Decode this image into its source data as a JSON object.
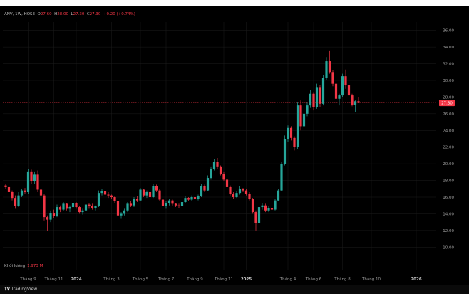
{
  "header": {
    "symbol": "ANV, 1W, HOSE",
    "o_label": "O",
    "o_value": "27.60",
    "h_label": "H",
    "h_value": "28.00",
    "l_label": "L",
    "l_value": "27.30",
    "c_label": "C",
    "c_value": "27.30",
    "change": "+0.20 (+0.74%)"
  },
  "volume": {
    "label": "Khối lượng",
    "value": "1.973 M"
  },
  "footer": {
    "brand": "TradingView"
  },
  "colors": {
    "up": "#26a69a",
    "down": "#f23645",
    "bg": "#000000",
    "grid": "#1c1c1c"
  },
  "chart_data": {
    "type": "candlestick",
    "ylim": [
      9,
      37
    ],
    "y_ticks": [
      "10.00",
      "12.00",
      "14.00",
      "16.00",
      "18.00",
      "20.00",
      "22.00",
      "24.00",
      "26.00",
      "28.00",
      "30.00",
      "32.00",
      "34.00",
      "36.00"
    ],
    "last_price": "27.30",
    "x_ticks": [
      {
        "label": "Tháng 9",
        "bold": false,
        "pos": 7
      },
      {
        "label": "Tháng 11",
        "bold": false,
        "pos": 15
      },
      {
        "label": "2024",
        "bold": true,
        "pos": 22
      },
      {
        "label": "Tháng 3",
        "bold": false,
        "pos": 33
      },
      {
        "label": "Tháng 5",
        "bold": false,
        "pos": 42
      },
      {
        "label": "Tháng 7",
        "bold": false,
        "pos": 50
      },
      {
        "label": "Tháng 9",
        "bold": false,
        "pos": 59
      },
      {
        "label": "Tháng 11",
        "bold": false,
        "pos": 68
      },
      {
        "label": "2025",
        "bold": true,
        "pos": 75
      },
      {
        "label": "Tháng 4",
        "bold": false,
        "pos": 88
      },
      {
        "label": "Tháng 6",
        "bold": false,
        "pos": 96
      },
      {
        "label": "Tháng 8",
        "bold": false,
        "pos": 105
      },
      {
        "label": "Tháng 10",
        "bold": false,
        "pos": 114
      },
      {
        "label": "2026",
        "bold": true,
        "pos": 128
      }
    ],
    "ohlc": [
      [
        17.4,
        17.6,
        17.0,
        17.2
      ],
      [
        17.2,
        17.3,
        16.4,
        16.6
      ],
      [
        16.6,
        16.8,
        15.6,
        15.9
      ],
      [
        15.9,
        16.2,
        14.6,
        14.9
      ],
      [
        14.9,
        16.6,
        14.8,
        16.2
      ],
      [
        16.2,
        17.0,
        16.0,
        16.8
      ],
      [
        16.8,
        17.1,
        16.4,
        16.6
      ],
      [
        16.6,
        19.4,
        16.4,
        19.0
      ],
      [
        19.0,
        19.3,
        17.6,
        17.9
      ],
      [
        17.9,
        19.0,
        17.6,
        18.7
      ],
      [
        18.7,
        19.2,
        16.6,
        16.9
      ],
      [
        16.9,
        17.0,
        15.8,
        16.2
      ],
      [
        16.2,
        16.4,
        13.2,
        13.6
      ],
      [
        13.6,
        13.8,
        11.9,
        13.3
      ],
      [
        13.3,
        14.4,
        13.0,
        14.1
      ],
      [
        14.1,
        14.5,
        13.5,
        13.7
      ],
      [
        13.7,
        15.1,
        13.6,
        14.8
      ],
      [
        14.8,
        15.0,
        14.2,
        14.5
      ],
      [
        14.5,
        15.4,
        14.3,
        15.2
      ],
      [
        15.2,
        15.3,
        14.4,
        14.6
      ],
      [
        14.6,
        15.0,
        14.2,
        14.8
      ],
      [
        14.8,
        15.6,
        14.6,
        15.3
      ],
      [
        15.3,
        15.4,
        14.6,
        14.8
      ],
      [
        14.8,
        14.9,
        14.0,
        14.2
      ],
      [
        14.2,
        14.6,
        13.9,
        14.4
      ],
      [
        14.4,
        15.4,
        14.3,
        15.1
      ],
      [
        15.1,
        15.3,
        14.6,
        14.9
      ],
      [
        14.9,
        15.2,
        14.5,
        14.7
      ],
      [
        14.7,
        15.0,
        14.4,
        14.9
      ],
      [
        14.9,
        16.8,
        14.8,
        16.5
      ],
      [
        16.5,
        17.0,
        16.2,
        16.7
      ],
      [
        16.7,
        16.8,
        16.0,
        16.3
      ],
      [
        16.3,
        16.6,
        15.9,
        16.2
      ],
      [
        16.2,
        16.3,
        15.8,
        16.0
      ],
      [
        16.0,
        16.1,
        15.3,
        15.5
      ],
      [
        15.5,
        15.7,
        13.6,
        13.8
      ],
      [
        13.8,
        14.2,
        13.4,
        14.0
      ],
      [
        14.0,
        14.6,
        13.8,
        14.4
      ],
      [
        14.4,
        15.4,
        14.2,
        15.2
      ],
      [
        15.2,
        15.5,
        14.8,
        15.0
      ],
      [
        15.0,
        16.0,
        14.8,
        15.8
      ],
      [
        15.8,
        16.1,
        15.4,
        15.6
      ],
      [
        15.6,
        17.1,
        15.5,
        16.9
      ],
      [
        16.9,
        17.0,
        16.0,
        16.2
      ],
      [
        16.2,
        16.8,
        15.9,
        16.6
      ],
      [
        16.6,
        16.7,
        15.8,
        16.0
      ],
      [
        16.0,
        17.6,
        15.9,
        17.3
      ],
      [
        17.3,
        17.5,
        16.6,
        16.8
      ],
      [
        16.8,
        17.0,
        15.5,
        15.7
      ],
      [
        15.7,
        15.9,
        14.6,
        14.9
      ],
      [
        14.9,
        15.5,
        14.6,
        15.3
      ],
      [
        15.3,
        15.8,
        15.0,
        15.6
      ],
      [
        15.6,
        15.7,
        15.0,
        15.2
      ],
      [
        15.2,
        15.3,
        14.8,
        15.0
      ],
      [
        15.0,
        15.2,
        14.7,
        14.9
      ],
      [
        14.9,
        15.6,
        14.8,
        15.4
      ],
      [
        15.4,
        16.1,
        15.3,
        15.9
      ],
      [
        15.9,
        16.0,
        15.5,
        15.7
      ],
      [
        15.7,
        16.2,
        15.5,
        16.0
      ],
      [
        16.0,
        16.4,
        15.7,
        15.8
      ],
      [
        15.8,
        16.3,
        15.6,
        16.1
      ],
      [
        16.1,
        17.6,
        16.0,
        17.3
      ],
      [
        17.3,
        17.5,
        16.6,
        16.8
      ],
      [
        16.8,
        18.6,
        16.7,
        18.3
      ],
      [
        18.3,
        19.6,
        18.1,
        19.4
      ],
      [
        19.4,
        20.6,
        19.2,
        20.2
      ],
      [
        20.2,
        20.7,
        19.4,
        19.6
      ],
      [
        19.6,
        19.8,
        18.6,
        18.8
      ],
      [
        18.8,
        19.0,
        17.9,
        18.1
      ],
      [
        18.1,
        18.3,
        17.0,
        17.2
      ],
      [
        17.2,
        17.4,
        16.2,
        16.4
      ],
      [
        16.4,
        16.6,
        15.8,
        16.0
      ],
      [
        16.0,
        16.7,
        15.9,
        16.5
      ],
      [
        16.5,
        17.3,
        16.3,
        17.0
      ],
      [
        17.0,
        17.1,
        16.6,
        16.8
      ],
      [
        16.8,
        17.0,
        16.2,
        16.4
      ],
      [
        16.4,
        16.6,
        15.6,
        15.8
      ],
      [
        15.8,
        15.9,
        14.0,
        14.2
      ],
      [
        14.2,
        14.4,
        12.0,
        12.9
      ],
      [
        12.9,
        15.1,
        12.8,
        14.8
      ],
      [
        14.8,
        15.3,
        14.5,
        15.0
      ],
      [
        15.0,
        15.2,
        14.2,
        14.4
      ],
      [
        14.4,
        14.9,
        14.2,
        14.7
      ],
      [
        14.7,
        15.0,
        14.3,
        14.5
      ],
      [
        14.5,
        15.8,
        14.4,
        15.6
      ],
      [
        15.6,
        17.0,
        15.5,
        16.8
      ],
      [
        16.8,
        20.2,
        16.7,
        20.0
      ],
      [
        20.0,
        23.4,
        19.8,
        23.0
      ],
      [
        23.0,
        24.6,
        22.6,
        24.3
      ],
      [
        24.3,
        24.5,
        22.8,
        23.1
      ],
      [
        23.1,
        23.3,
        21.6,
        22.0
      ],
      [
        22.0,
        27.4,
        21.8,
        27.0
      ],
      [
        27.0,
        27.6,
        24.0,
        24.5
      ],
      [
        24.5,
        26.4,
        24.2,
        26.0
      ],
      [
        26.0,
        27.4,
        25.7,
        27.0
      ],
      [
        27.0,
        28.8,
        26.7,
        28.4
      ],
      [
        28.4,
        28.6,
        26.4,
        26.8
      ],
      [
        26.8,
        29.6,
        26.6,
        29.2
      ],
      [
        29.2,
        29.4,
        26.8,
        27.2
      ],
      [
        27.2,
        30.6,
        27.0,
        30.3
      ],
      [
        30.3,
        32.8,
        30.1,
        32.3
      ],
      [
        32.3,
        33.6,
        30.8,
        31.0
      ],
      [
        31.0,
        31.2,
        29.3,
        29.6
      ],
      [
        29.6,
        30.0,
        27.4,
        27.8
      ],
      [
        27.8,
        28.4,
        27.0,
        28.2
      ],
      [
        28.2,
        30.8,
        28.0,
        30.5
      ],
      [
        30.5,
        31.3,
        29.0,
        29.4
      ],
      [
        29.4,
        29.6,
        27.9,
        28.2
      ],
      [
        28.2,
        28.4,
        26.9,
        27.1
      ],
      [
        27.1,
        27.6,
        26.2,
        27.5
      ],
      [
        27.5,
        28.0,
        27.3,
        27.3
      ]
    ]
  }
}
